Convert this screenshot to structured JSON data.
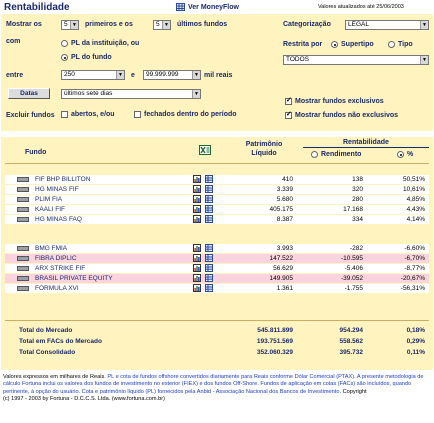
{
  "page": {
    "title": "Rentabilidade",
    "view_link": "Ver MoneyFlow",
    "updated": "Valores atualizados até 25/06/2003"
  },
  "filters": {
    "show_label": "Mostrar os",
    "top_n": "5",
    "first_label": "primeiros e os",
    "bottom_n": "5",
    "last_label": "últimos fundos",
    "with_label": "com",
    "opt_pl_instituicao": "PL da instituição, ou",
    "opt_pl_fundo": "PL do fundo",
    "between_label": "entre",
    "min_value": "250",
    "and_label": "e",
    "max_value": "99.999.999",
    "mil_reais": "mil reais",
    "dates_button": "Datas",
    "period": "últimos sete dias",
    "exclude_label": "Excluir fundos",
    "chk_abertos": "abertos, e/ou",
    "chk_fechados": "fechados dentro do período",
    "categorization_label": "Categorização",
    "categorization": "LEGAL",
    "restrict_label": "Restrita por",
    "opt_supertipo": "Supertipo",
    "opt_tipo": "Tipo",
    "restrict_value": "TODOS",
    "chk_exclusivos": "Mostrar fundos exclusivos",
    "chk_nao_exclusivos": "Mostrar fundos não exclusivos"
  },
  "table": {
    "col_fundo": "Fundo",
    "col_patrimonio_1": "Patrimônio",
    "col_patrimonio_2": "Líquido",
    "col_rentabilidade": "Rentabilidade",
    "sub_rendimento": "Rendimento",
    "sub_pct": "%",
    "excel_icon": "excel-icon",
    "top_rows": [
      {
        "name": "FIF BHP BILLITON",
        "pl": "410",
        "rend": "138",
        "pct": "50,51%"
      },
      {
        "name": "HG MINAS FIF",
        "pl": "3.339",
        "rend": "320",
        "pct": "10,61%"
      },
      {
        "name": "PLIM FIA",
        "pl": "5.680",
        "rend": "280",
        "pct": "4,85%"
      },
      {
        "name": "KAALI FIF",
        "pl": "405.175",
        "rend": "17.168",
        "pct": "4,43%"
      },
      {
        "name": "HG MINAS FAQ",
        "pl": "8.387",
        "rend": "334",
        "pct": "4,14%"
      }
    ],
    "bottom_rows": [
      {
        "name": "BMG FMIA",
        "pl": "3.993",
        "rend": "-282",
        "pct": "-6,60%"
      },
      {
        "name": "FIBRA DIPLIC",
        "pl": "147.522",
        "rend": "-10.595",
        "pct": "-6,70%"
      },
      {
        "name": "ARX STRIKE FIF",
        "pl": "56.629",
        "rend": "-5.406",
        "pct": "-8,77%"
      },
      {
        "name": "BRASIL PRIVATE EQUITY",
        "pl": "149.905",
        "rend": "-39.052",
        "pct": "-20,67%"
      },
      {
        "name": "FORMULA XVI",
        "pl": "1.361",
        "rend": "-1.755",
        "pct": "-56,31%"
      }
    ],
    "totals": [
      {
        "label": "Total do Mercado",
        "pl": "545.811.899",
        "rend": "954.294",
        "pct": "0,18%"
      },
      {
        "label": "Total em FACs do Mercado",
        "pl": "193.751.569",
        "rend": "558.562",
        "pct": "0,29%"
      },
      {
        "label": "Total Consolidado",
        "pl": "352.060.329",
        "rend": "395.732",
        "pct": "0,11%"
      }
    ]
  },
  "footer": {
    "line1_a": "Valores expressos em milhares de Reais.",
    "line1_b": "PL e cota de fundos offshore convertidos diariamente para Reais conforme Dólar Comercial (PTAX). A presente metodologia de cálculo Fortuna inclui os valores dos fundos de investimento no exterior (FIEX) e dos fundos Off-Shore. Fundos de aplicação em cotas (FACs) são incluídos, quando pertinente, à opção do usuário. Cota e patrimônio líquido (PL) fornecidos pela Anbid - Associação Nacional dos Bancos de Investimento.",
    "line1_c": "Copyright",
    "line2": "(c) 1997 - 2003 by Fortuna - D.C.C.S. Ltda. (www.fortuna.com.br)"
  }
}
